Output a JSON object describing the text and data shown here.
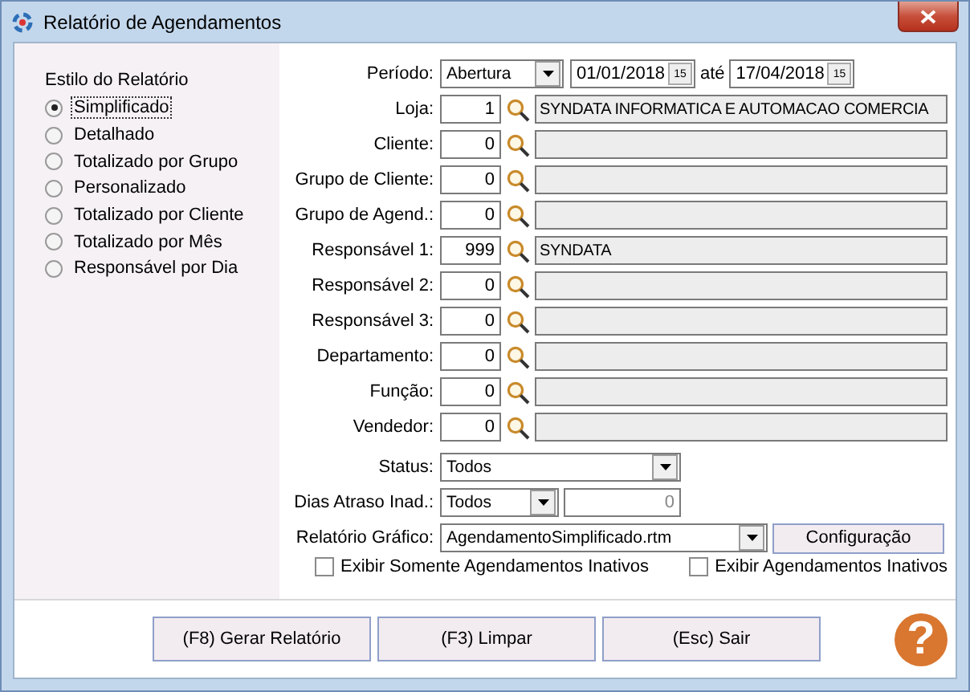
{
  "window": {
    "title": "Relatório de Agendamentos"
  },
  "report_style": {
    "title": "Estilo do Relatório",
    "options": [
      {
        "label": "Simplificado",
        "selected": true
      },
      {
        "label": "Detalhado",
        "selected": false
      },
      {
        "label": "Totalizado por Grupo",
        "selected": false
      },
      {
        "label": "Personalizado",
        "selected": false
      },
      {
        "label": "Totalizado por Cliente",
        "selected": false
      },
      {
        "label": "Totalizado por Mês",
        "selected": false
      },
      {
        "label": "Responsável por Dia",
        "selected": false
      }
    ]
  },
  "period": {
    "label": "Período:",
    "type": "Abertura",
    "from": "01/01/2018",
    "from_picker": "15",
    "to_label": "até",
    "to": "17/04/2018",
    "to_picker": "15"
  },
  "lookups": [
    {
      "label": "Loja:",
      "code": "1",
      "description": "SYNDATA INFORMATICA E AUTOMACAO COMERCIA"
    },
    {
      "label": "Cliente:",
      "code": "0"
    },
    {
      "label": "Grupo de Cliente:",
      "code": "0"
    },
    {
      "label": "Grupo de Agend.:",
      "code": "0"
    },
    {
      "label": "Responsável 1:",
      "code": "999",
      "description": "SYNDATA"
    },
    {
      "label": "Responsável 2:",
      "code": "0"
    },
    {
      "label": "Responsável 3:",
      "code": "0"
    },
    {
      "label": "Departamento:",
      "code": "0"
    },
    {
      "label": "Função:",
      "code": "0"
    },
    {
      "label": "Vendedor:",
      "code": "0"
    }
  ],
  "status": {
    "label": "Status:",
    "value": "Todos"
  },
  "overdue_days": {
    "label": "Dias Atraso Inad.:",
    "value": "Todos",
    "days": "0"
  },
  "graphic_report": {
    "label": "Relatório Gráfico:",
    "value": "AgendamentoSimplificado.rtm",
    "button": {
      "label": "Configuração"
    }
  },
  "checkboxes": [
    {
      "label": "Exibir Somente Agendamentos Inativos",
      "checked": false
    },
    {
      "label": "Exibir Agendamentos Inativos",
      "checked": false
    }
  ],
  "buttons": [
    {
      "label": "(F8) Gerar Relatório"
    },
    {
      "label": "(F3) Limpar"
    },
    {
      "label": "(Esc) Sair"
    }
  ],
  "help": {
    "glyph": "?"
  }
}
